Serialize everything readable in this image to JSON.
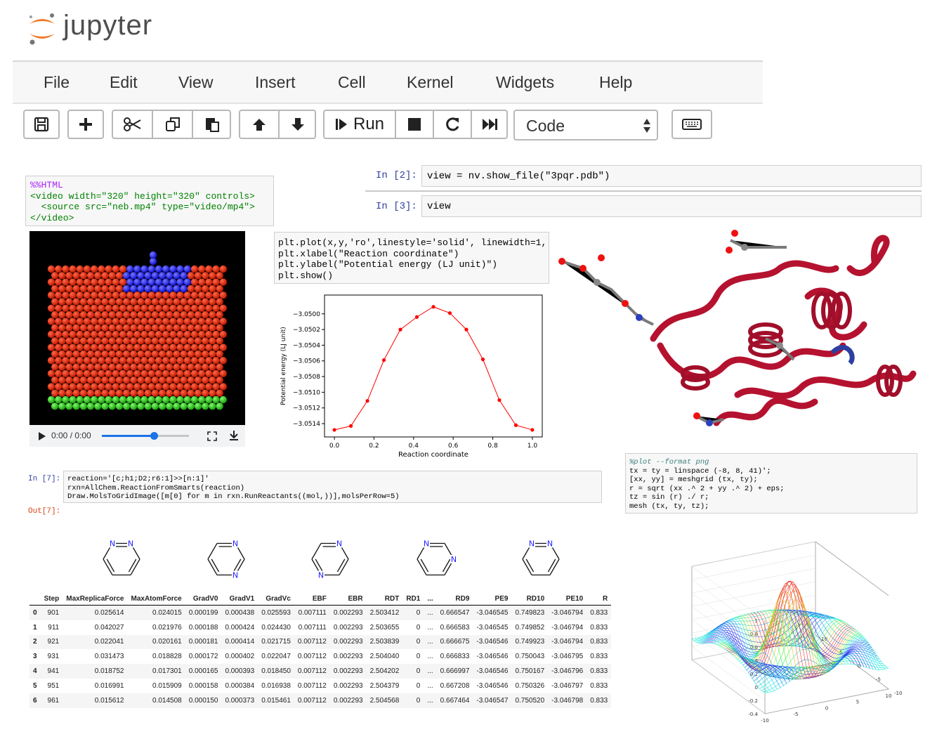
{
  "app": {
    "logo_text": "jupyter"
  },
  "menu": [
    "File",
    "Edit",
    "View",
    "Insert",
    "Cell",
    "Kernel",
    "Widgets",
    "Help"
  ],
  "toolbar": {
    "icons": [
      "save-icon",
      "plus-icon",
      "scissors-icon",
      "copy-icon",
      "paste-icon",
      "arrow-up-icon",
      "arrow-down-icon",
      "run-icon",
      "stop-icon",
      "restart-icon",
      "fast-forward-icon",
      "keyboard-icon"
    ],
    "run_label": "Run",
    "cell_type": "Code"
  },
  "html_cell": {
    "lines": [
      "%%HTML",
      "<video width=\"320\" height=\"320\" controls>",
      "  <source src=\"neb.mp4\" type=\"video/mp4\">",
      "</video>"
    ]
  },
  "video": {
    "time": "0:00 / 0:00",
    "progress": 0.6
  },
  "nglview": {
    "prompt2": "In [2]:",
    "code2": "view = nv.show_file(\"3pqr.pdb\")",
    "prompt3": "In [3]:",
    "code3": "view"
  },
  "plot_cell": {
    "lines": [
      "plt.plot(x,y,'ro',linestyle='solid', linewidth=1,",
      "plt.xlabel(\"Reaction coordinate\")",
      "plt.ylabel(\"Potential energy (LJ unit)\")",
      "plt.show()"
    ]
  },
  "chart_data": {
    "type": "line",
    "x": [
      0.0,
      0.0833,
      0.1667,
      0.25,
      0.3333,
      0.4167,
      0.5,
      0.5833,
      0.6667,
      0.75,
      0.8333,
      0.9167,
      1.0
    ],
    "y": [
      -3.05148,
      -3.05143,
      -3.05111,
      -3.05059,
      -3.0502,
      -3.05004,
      -3.04991,
      -3.04999,
      -3.0502,
      -3.05058,
      -3.0511,
      -3.05142,
      -3.05148
    ],
    "xlabel": "Reaction coordinate",
    "ylabel": "Potential energy (LJ unit)",
    "xticks": [
      "0.0",
      "0.2",
      "0.4",
      "0.6",
      "0.8",
      "1.0"
    ],
    "yticks": [
      "-3.0500",
      "-3.0502",
      "-3.0504",
      "-3.0506",
      "-3.0508",
      "-3.0510",
      "-3.0512",
      "-3.0514"
    ],
    "xlim": [
      -0.05,
      1.05
    ],
    "ylim": [
      -3.05157,
      -3.04976
    ],
    "color": "#ff0000"
  },
  "rdkit_cell": {
    "prompt": "In [7]:",
    "lines": [
      "reaction='[c;h1;D2;r6:1]>>[n:1]'",
      "rxn=AllChem.ReactionFromSmarts(reaction)",
      "Draw.MolsToGridImage([m[0] for m in rxn.RunReactants((mol,))],molsPerRow=5)"
    ],
    "out_prompt": "Out[7]:"
  },
  "octave_cell": {
    "lines": [
      "%plot --format png",
      "tx = ty = linspace (-8, 8, 41)';",
      "[xx, yy] = meshgrid (tx, ty);",
      "r = sqrt (xx .^ 2 + yy .^ 2) + eps;",
      "tz = sin (r) ./ r;",
      "mesh (tx, ty, tz);"
    ]
  },
  "mesh_plot": {
    "zticks": [
      "1",
      "0.8",
      "0.6",
      "0.4",
      "0.2",
      "0",
      "-0.2",
      "-0.4"
    ],
    "xticks": [
      "-10",
      "-5",
      "0",
      "5",
      "10"
    ],
    "yticks": [
      "-10",
      "-5",
      "0",
      "5",
      "10"
    ]
  },
  "dataframe": {
    "columns": [
      "",
      "Step",
      "MaxReplicaForce",
      "MaxAtomForce",
      "GradV0",
      "GradV1",
      "GradVc",
      "EBF",
      "EBR",
      "RDT",
      "RD1",
      "...",
      "RD9",
      "PE9",
      "RD10",
      "PE10",
      "R"
    ],
    "rows": [
      [
        "0",
        "901",
        "0.025614",
        "0.024015",
        "0.000199",
        "0.000438",
        "0.025593",
        "0.007111",
        "0.002293",
        "2.503412",
        "0",
        "...",
        "0.666547",
        "-3.046545",
        "0.749823",
        "-3.046794",
        "0.833"
      ],
      [
        "1",
        "911",
        "0.042027",
        "0.021976",
        "0.000188",
        "0.000424",
        "0.024430",
        "0.007111",
        "0.002293",
        "2.503655",
        "0",
        "...",
        "0.666583",
        "-3.046545",
        "0.749852",
        "-3.046794",
        "0.833"
      ],
      [
        "2",
        "921",
        "0.022041",
        "0.020161",
        "0.000181",
        "0.000414",
        "0.021715",
        "0.007112",
        "0.002293",
        "2.503839",
        "0",
        "...",
        "0.666675",
        "-3.046546",
        "0.749923",
        "-3.046794",
        "0.833"
      ],
      [
        "3",
        "931",
        "0.031473",
        "0.018828",
        "0.000172",
        "0.000402",
        "0.022047",
        "0.007112",
        "0.002293",
        "2.504040",
        "0",
        "...",
        "0.666833",
        "-3.046546",
        "0.750043",
        "-3.046795",
        "0.833"
      ],
      [
        "4",
        "941",
        "0.018752",
        "0.017301",
        "0.000165",
        "0.000393",
        "0.018450",
        "0.007112",
        "0.002293",
        "2.504202",
        "0",
        "...",
        "0.666997",
        "-3.046546",
        "0.750167",
        "-3.046796",
        "0.833"
      ],
      [
        "5",
        "951",
        "0.016991",
        "0.015909",
        "0.000158",
        "0.000384",
        "0.016938",
        "0.007112",
        "0.002293",
        "2.504379",
        "0",
        "...",
        "0.667208",
        "-3.046546",
        "0.750326",
        "-3.046797",
        "0.833"
      ],
      [
        "6",
        "961",
        "0.015612",
        "0.014508",
        "0.000150",
        "0.000373",
        "0.015461",
        "0.007112",
        "0.002293",
        "2.504568",
        "0",
        "...",
        "0.667464",
        "-3.046547",
        "0.750520",
        "-3.046798",
        "0.833"
      ]
    ]
  }
}
